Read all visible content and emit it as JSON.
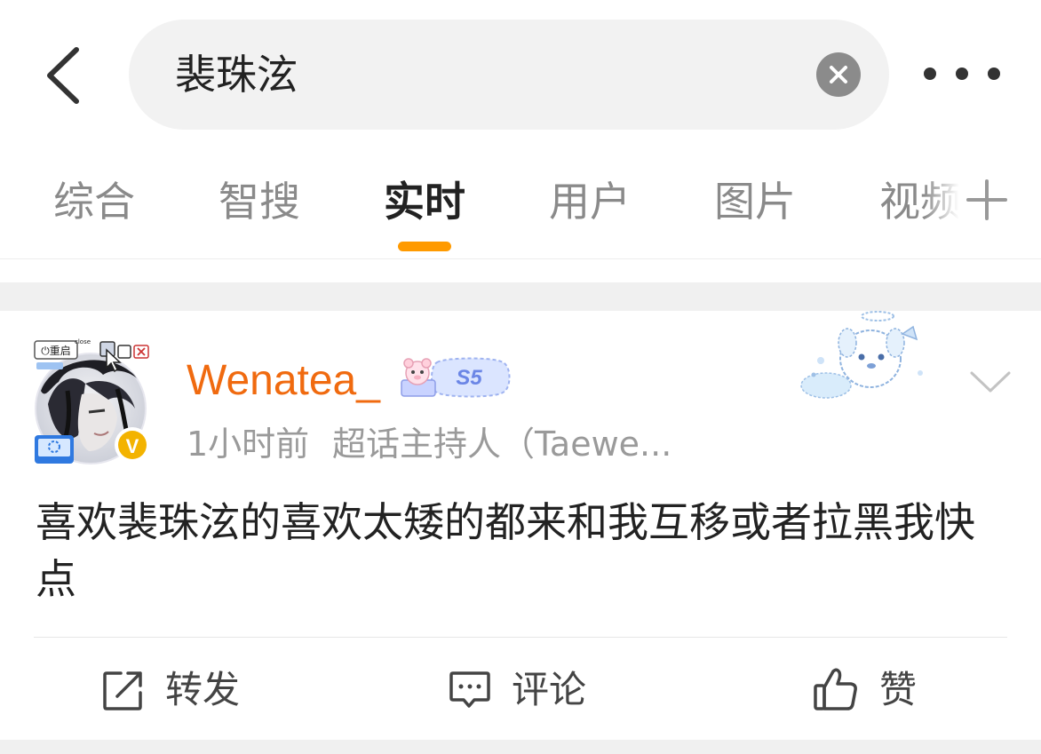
{
  "search": {
    "query": "裴珠泫"
  },
  "icons": {
    "back": "chevron-left-icon",
    "clear": "clear-icon",
    "more": "more-dots-icon",
    "add_tab": "plus-icon",
    "post_menu": "chevron-down-icon",
    "repost": "repost-icon",
    "comment": "comment-icon",
    "like": "thumbs-up-icon"
  },
  "tabs": [
    {
      "label": "综合",
      "active": false
    },
    {
      "label": "智搜",
      "active": false
    },
    {
      "label": "实时",
      "active": true
    },
    {
      "label": "用户",
      "active": false
    },
    {
      "label": "图片",
      "active": false
    },
    {
      "label": "视频",
      "active": false
    }
  ],
  "post": {
    "username": "Wenatea_",
    "level_badge": "S5",
    "time": "1小时前",
    "role": "超话主持人（Taewe...",
    "text": "喜欢裴珠泫的喜欢太矮的都来和我互移或者拉黑我快点",
    "avatar": {
      "window_button": "⏻重启",
      "window_label": "close",
      "verified_mark": "V"
    },
    "actions": {
      "repost": "转发",
      "comment": "评论",
      "like": "赞"
    }
  },
  "colors": {
    "username": "#f06a0f",
    "tab_indicator": "#ff9a00",
    "verified_badge": "#f3b300",
    "search_bg": "#f2f2f2",
    "section_gap": "#f0f0f0"
  }
}
